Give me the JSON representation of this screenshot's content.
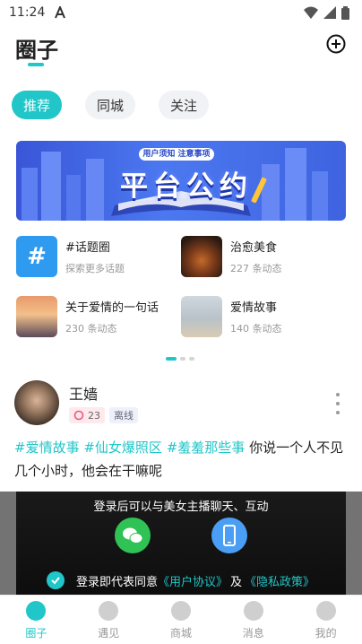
{
  "status_bar": {
    "time": "11:24"
  },
  "header": {
    "title": "圈子"
  },
  "tabs": [
    {
      "label": "推荐",
      "active": true
    },
    {
      "label": "同城",
      "active": false
    },
    {
      "label": "关注",
      "active": false
    }
  ],
  "banner": {
    "subtitle": "用户须知 注意事项",
    "title": "平台公约"
  },
  "topics": [
    {
      "name": "#话题圈",
      "meta": "探索更多话题"
    },
    {
      "name": "治愈美食",
      "meta": "227 条动态"
    },
    {
      "name": "关于爱情的一句话",
      "meta": "230 条动态"
    },
    {
      "name": "爱情故事",
      "meta": "140 条动态"
    }
  ],
  "post": {
    "username": "王嫱",
    "level": "23",
    "status": "离线",
    "tags": [
      "#爱情故事",
      "#仙女爆照区",
      "#羞羞那些事"
    ],
    "text": "你说一个人不见几个小时，他会在干嘛呢"
  },
  "login_overlay": {
    "message": "登录后可以与美女主播聊天、互动",
    "agree_prefix": "登录即代表同意",
    "user_agreement": "《用户协议》",
    "and": "及",
    "privacy_policy": "《隐私政策》"
  },
  "tabbar": [
    {
      "label": "圈子",
      "active": true
    },
    {
      "label": "遇见",
      "active": false
    },
    {
      "label": "商城",
      "active": false
    },
    {
      "label": "消息",
      "active": false
    },
    {
      "label": "我的",
      "active": false
    }
  ],
  "colors": {
    "accent": "#20c6c8",
    "wechat": "#2ec354",
    "phone": "#4a9ff5"
  }
}
